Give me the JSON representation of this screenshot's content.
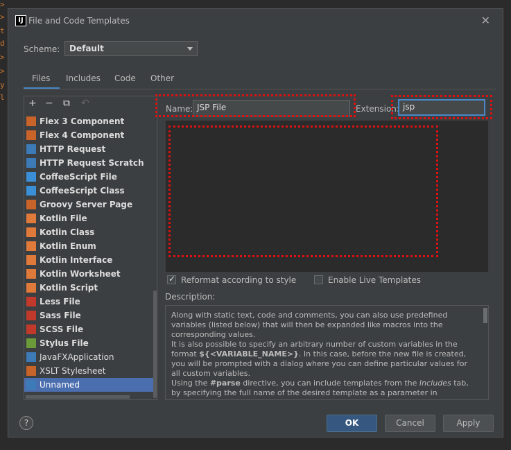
{
  "window": {
    "title": "File and Code Templates",
    "app_icon_label": "IJ"
  },
  "scheme": {
    "label": "Scheme:",
    "value": "Default"
  },
  "tabs": [
    {
      "label": "Files"
    },
    {
      "label": "Includes"
    },
    {
      "label": "Code"
    },
    {
      "label": "Other"
    }
  ],
  "toolbar": {
    "add": "+",
    "remove": "−",
    "copy": "⧉",
    "reset": "↶"
  },
  "templates": [
    {
      "name": "Flex 3 Component",
      "icon_color": "#c8642a",
      "bold": true
    },
    {
      "name": "Flex 4 Component",
      "icon_color": "#c8642a",
      "bold": true
    },
    {
      "name": "HTTP Request",
      "icon_color": "#3d7ab8",
      "bold": true
    },
    {
      "name": "HTTP Request Scratch",
      "icon_color": "#3d7ab8",
      "bold": true
    },
    {
      "name": "CoffeeScript File",
      "icon_color": "#3a8fd6",
      "bold": true
    },
    {
      "name": "CoffeeScript Class",
      "icon_color": "#3a8fd6",
      "bold": true
    },
    {
      "name": "Groovy Server Page",
      "icon_color": "#c8642a",
      "bold": true
    },
    {
      "name": "Kotlin File",
      "icon_color": "#e07a3a",
      "bold": true
    },
    {
      "name": "Kotlin Class",
      "icon_color": "#e07a3a",
      "bold": true
    },
    {
      "name": "Kotlin Enum",
      "icon_color": "#e07a3a",
      "bold": true
    },
    {
      "name": "Kotlin Interface",
      "icon_color": "#e07a3a",
      "bold": true
    },
    {
      "name": "Kotlin Worksheet",
      "icon_color": "#e07a3a",
      "bold": true
    },
    {
      "name": "Kotlin Script",
      "icon_color": "#e07a3a",
      "bold": true
    },
    {
      "name": "Less File",
      "icon_color": "#c0392b",
      "bold": true
    },
    {
      "name": "Sass File",
      "icon_color": "#c0392b",
      "bold": true
    },
    {
      "name": "SCSS File",
      "icon_color": "#c0392b",
      "bold": true
    },
    {
      "name": "Stylus File",
      "icon_color": "#6a9a3a",
      "bold": true
    },
    {
      "name": "JavaFXApplication",
      "icon_color": "#3d7ab8",
      "bold": false
    },
    {
      "name": "XSLT Stylesheet",
      "icon_color": "#c8642a",
      "bold": false
    },
    {
      "name": "Unnamed",
      "icon_color": "#3d7ab8",
      "bold": false,
      "selected": true
    }
  ],
  "form": {
    "name_label": "Name:",
    "name_value": "JSP File",
    "extension_label": "Extension:",
    "extension_value": "jsp"
  },
  "options": {
    "reformat_label": "Reformat according to style",
    "reformat_checked": true,
    "live_templates_label": "Enable Live Templates",
    "live_templates_checked": false
  },
  "description": {
    "label": "Description:",
    "p1": "Along with static text, code and comments, you can also use predefined variables (listed below) that will then be expanded like macros into the corresponding values.",
    "p2a": "It is also possible to specify an arbitrary number of custom variables in the format ",
    "p2b": "${<VARIABLE_NAME>}",
    "p2c": ". In this case, before the new file is created, you will be prompted with a dialog where you can define particular values for all custom variables.",
    "p3a": "Using the ",
    "p3b": "#parse",
    "p3c": " directive, you can include templates from the ",
    "p3d": "Includes",
    "p3e": " tab, by specifying the full name of the desired template as a parameter in"
  },
  "buttons": {
    "help": "?",
    "ok": "OK",
    "cancel": "Cancel",
    "apply": "Apply"
  },
  "colors": {
    "accent": "#4a88c7",
    "selection": "#4b6eaf",
    "highlight": "#e01010"
  }
}
